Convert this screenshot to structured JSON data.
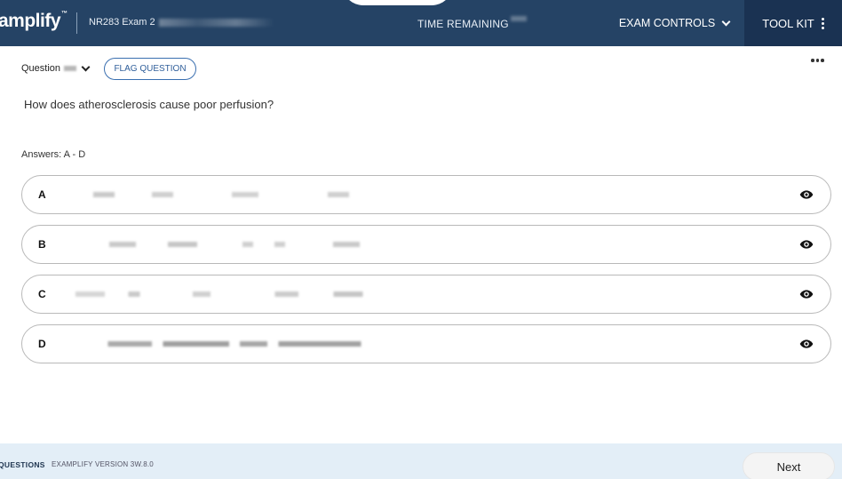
{
  "header": {
    "brand": "amplify",
    "brand_sup": "™",
    "exam_title": "NR283 Exam 2",
    "time_label": "TIME REMAINING",
    "exam_controls_label": "EXAM CONTROLS",
    "toolkit_label": "TOOL KIT"
  },
  "question": {
    "label": "Question",
    "flag_label": "FLAG QUESTION",
    "text": "How does atherosclerosis cause poor perfusion?",
    "answers_label": "Answers: A - D"
  },
  "answers": [
    {
      "letter": "A"
    },
    {
      "letter": "B"
    },
    {
      "letter": "C"
    },
    {
      "letter": "D"
    }
  ],
  "footer": {
    "questions_label": "QUESTIONS",
    "version_label": "EXAMPLIFY VERSION 3W.8.0",
    "next_label": "Next"
  },
  "colors": {
    "header_bg": "#254365",
    "toolkit_bg": "#1a3252",
    "footer_bg": "#e3eef7",
    "accent": "#3a6fb0"
  },
  "icons": [
    "chevron-down-icon",
    "kebab-vertical-icon",
    "more-horizontal-icon",
    "eye-icon"
  ]
}
